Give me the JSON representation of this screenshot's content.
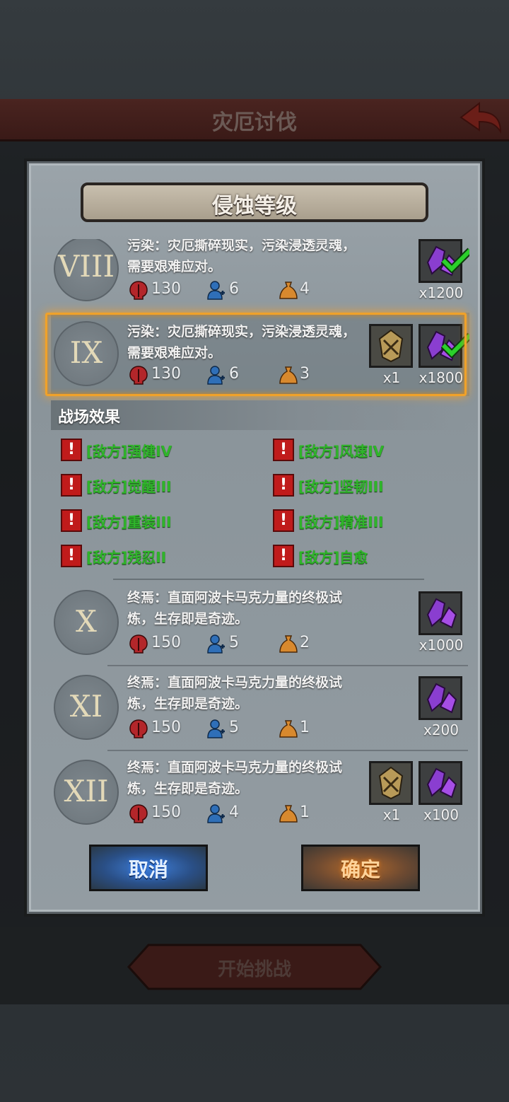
{
  "header": {
    "title": "灾厄讨伐"
  },
  "dialog": {
    "title": "侵蚀等级"
  },
  "levels": [
    {
      "roman": "VIII",
      "desc": "污染：灾厄撕碎现实，污染浸透灵魂，需要艰难应对。",
      "skull": "130",
      "ally": "6",
      "drop": "4",
      "rewards": [
        {
          "item": "crystal",
          "count": "x1200",
          "claimed": true
        }
      ]
    },
    {
      "roman": "IX",
      "desc": "污染：灾厄撕碎现实，污染浸透灵魂，需要艰难应对。",
      "skull": "130",
      "ally": "6",
      "drop": "3",
      "selected": true,
      "rewards": [
        {
          "item": "emblem",
          "count": "x1"
        },
        {
          "item": "crystal",
          "count": "x1800",
          "claimed": true
        }
      ]
    },
    {
      "roman": "X",
      "desc": "终焉：直面阿波卡马克力量的终极试炼，生存即是奇迹。",
      "skull": "150",
      "ally": "5",
      "drop": "2",
      "rewards": [
        {
          "item": "crystal",
          "count": "x1000"
        }
      ]
    },
    {
      "roman": "XI",
      "desc": "终焉：直面阿波卡马克力量的终极试炼，生存即是奇迹。",
      "skull": "150",
      "ally": "5",
      "drop": "1",
      "rewards": [
        {
          "item": "crystal",
          "count": "x200"
        }
      ]
    },
    {
      "roman": "XII",
      "desc": "终焉：直面阿波卡马克力量的终极试炼，生存即是奇迹。",
      "skull": "150",
      "ally": "4",
      "drop": "1",
      "rewards": [
        {
          "item": "emblem",
          "count": "x1"
        },
        {
          "item": "crystal",
          "count": "x100"
        }
      ]
    }
  ],
  "effects": {
    "title": "战场效果",
    "items": [
      "[敌方]强健IV",
      "[敌方]风速IV",
      "[敌方]觉醒III",
      "[敌方]坚韧III",
      "[敌方]重装III",
      "[敌方]精准III",
      "[敌方]残忍II",
      "[敌方]自愈"
    ]
  },
  "buttons": {
    "cancel": "取消",
    "confirm": "确定"
  },
  "footer": {
    "start": "开始挑战"
  },
  "colors": {
    "selected_glow": "#f0a22a",
    "effect_text": "#2fb52a",
    "effect_icon": "#c01b1b",
    "skull_icon": "#b3262a",
    "ally_icon": "#2f6fb8",
    "drop_icon": "#d8892e",
    "check": "#2bd02b",
    "crystal": "#8a3ed0"
  }
}
